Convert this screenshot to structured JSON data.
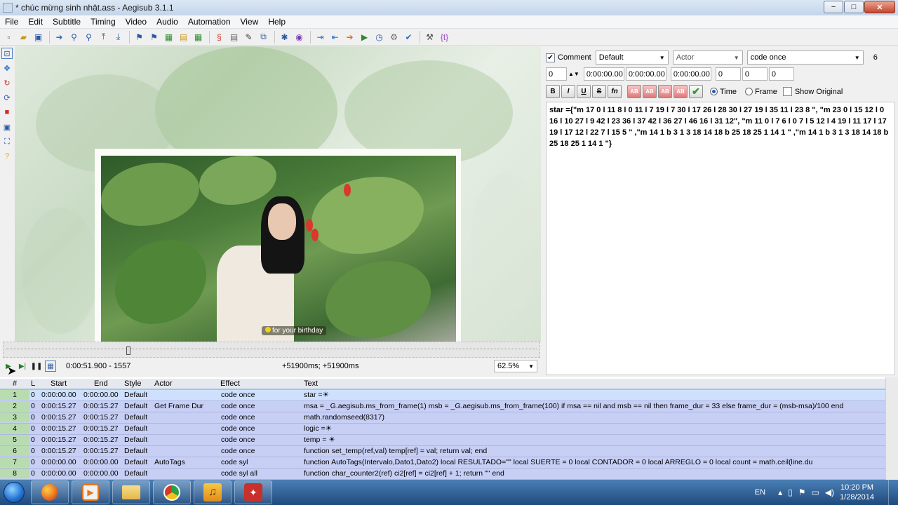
{
  "window": {
    "title": "* chúc mừng sinh nhật.ass - Aegisub 3.1.1",
    "minimize": "−",
    "maximize": "□",
    "close": "✕"
  },
  "menu": [
    "File",
    "Edit",
    "Subtitle",
    "Timing",
    "Video",
    "Audio",
    "Automation",
    "View",
    "Help"
  ],
  "toolbar_icons": [
    "new-file-icon",
    "open-file-icon",
    "save-file-icon",
    "jump-to-icon",
    "zoom-in-icon",
    "zoom-out-icon",
    "set-start-icon",
    "set-end-icon",
    "snap-icon",
    "properties-icon",
    "attachments-icon",
    "fonts-collector-icon",
    "resample-icon",
    "translation-icon",
    "spell-check-icon",
    "find-icon",
    "replace-icon",
    "shift-times-icon",
    "styles-manager-icon",
    "audio-icon",
    "video-details-icon",
    "timing-postprocessor-icon",
    "automation-icon",
    "options-icon",
    "tag-toggle-icon"
  ],
  "vtools": [
    "standard-tool-icon",
    "move-tool-icon",
    "rotate-z-icon",
    "rotate-xy-icon",
    "scale-tool-icon",
    "clip-tool-icon",
    "vector-clip-icon",
    "help-icon"
  ],
  "video": {
    "caption": "for your birthday"
  },
  "video_controls": {
    "time": "0:00:51.900 - 1557",
    "offset": "+51900ms; +51900ms",
    "zoom": "62.5%"
  },
  "edit": {
    "comment_label": "Comment",
    "style": "Default",
    "actor_placeholder": "Actor",
    "effect": "code once",
    "layer_display": "6",
    "layer": "0",
    "start": "0:00:00.00",
    "end": "0:00:00.00",
    "duration": "0:00:00.00",
    "margin_l": "0",
    "margin_r": "0",
    "margin_v": "0",
    "fmt": [
      "B",
      "I",
      "U",
      "S",
      "fn"
    ],
    "color_btns": [
      "AB",
      "AB",
      "AB",
      "AB"
    ],
    "time_label": "Time",
    "frame_label": "Frame",
    "show_original_label": "Show Original",
    "text": "star ={\"m 17 0 l 11 8 l 0 11 l 7 19 l 7 30 l 17 26 l 28 30 l 27 19 l 35 11 l 23 8 \",  \"m 23 0 l 15 12 l 0 16 l 10 27 l 9 42 l 23 36 l 37 42 l 36 27 l 46 16 l 31 12\", \"m 11 0 l 7 6 l 0 7 l 5 12 l 4 19 l 11 17 l 17 19 l 17 12 l 22 7 l 15 5 \"  ,\"m 14 1 b 3 1 3 18 14 18 b 25 18 25 1 14 1 \"  ,\"m 14 1 b 3 1 3 18 14 18 b 25 18 25 1 14 1 \"}"
  },
  "grid": {
    "headers": [
      "#",
      "L",
      "Start",
      "End",
      "Style",
      "Actor",
      "Effect",
      "Text"
    ],
    "rows": [
      {
        "n": "1",
        "l": "0",
        "start": "0:00:00.00",
        "end": "0:00:00.00",
        "style": "Default",
        "actor": "",
        "effect": "code once",
        "text": "star =☀"
      },
      {
        "n": "2",
        "l": "0",
        "start": "0:00:15.27",
        "end": "0:00:15.27",
        "style": "Default",
        "actor": "Get Frame Dur",
        "effect": "code once",
        "text": "msa = _G.aegisub.ms_from_frame(1) msb = _G.aegisub.ms_from_frame(100) if msa == nil and msb == nil then frame_dur = 33 else frame_dur = (msb-msa)/100 end"
      },
      {
        "n": "3",
        "l": "0",
        "start": "0:00:15.27",
        "end": "0:00:15.27",
        "style": "Default",
        "actor": "",
        "effect": "code once",
        "text": "math.randomseed(8317)"
      },
      {
        "n": "4",
        "l": "0",
        "start": "0:00:15.27",
        "end": "0:00:15.27",
        "style": "Default",
        "actor": "",
        "effect": "code once",
        "text": "logic =☀"
      },
      {
        "n": "5",
        "l": "0",
        "start": "0:00:15.27",
        "end": "0:00:15.27",
        "style": "Default",
        "actor": "",
        "effect": "code once",
        "text": "temp = ☀"
      },
      {
        "n": "6",
        "l": "0",
        "start": "0:00:15.27",
        "end": "0:00:15.27",
        "style": "Default",
        "actor": "",
        "effect": "code once",
        "text": "function set_temp(ref,val) temp[ref] = val; return val; end"
      },
      {
        "n": "7",
        "l": "0",
        "start": "0:00:00.00",
        "end": "0:00:00.00",
        "style": "Default",
        "actor": "AutoTags",
        "effect": "code syl",
        "text": "function AutoTags(Intervalo,Dato1,Dato2)          local RESULTADO=\"\"      local SUERTE = 0     local CONTADOR = 0      local ARREGLO = 0                          local count = math.ceil(line.du"
      },
      {
        "n": "8",
        "l": "0",
        "start": "0:00:00.00",
        "end": "0:00:00.00",
        "style": "Default",
        "actor": "",
        "effect": "code syl all",
        "text": "function char_counter2(ref) ci2[ref] = ci2[ref] + 1; return \"\" end"
      }
    ]
  },
  "taskbar": {
    "apps": [
      "firefox-icon",
      "media-player-icon",
      "file-explorer-icon",
      "chrome-icon",
      "music-player-icon",
      "aegisub-icon"
    ],
    "lang": "EN",
    "time": "10:20 PM",
    "date": "1/28/2014"
  }
}
